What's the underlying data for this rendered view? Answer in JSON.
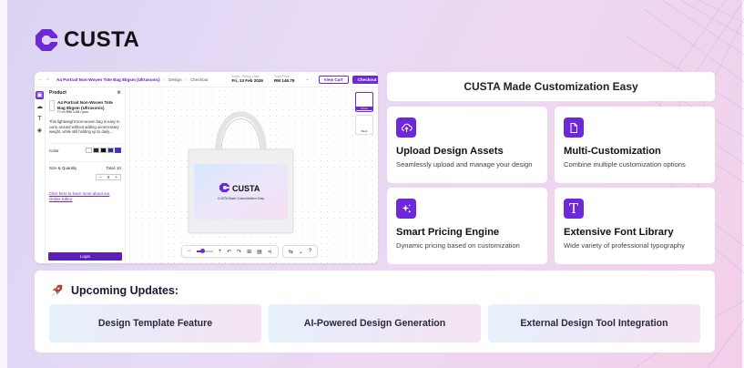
{
  "brand": {
    "name": "CUSTA",
    "accent": "#6d28d9"
  },
  "app": {
    "product_title": "A4 Portrait Non-Woven Tote Bag 8bgsm (Ultrasonic)",
    "breadcrumb_design": "Design",
    "breadcrumb_checkout": "Checkout",
    "pickup_label": "Estim. Pickup Date",
    "pickup_date": "Fri, 13 Feb 2026",
    "total_label": "Total Price",
    "total_price": "RM 146.79",
    "view_cart": "View Cart",
    "checkout": "Checkout",
    "panel_title": "Product",
    "product_name": "A4 Portrait Non-Woven Tote Bag 8bgsm (Ultrasonic)",
    "product_price_prefix": "From",
    "product_price": "RM 1.08 / pcs",
    "description": "This lightweight non-woven bag is easy to carry around without adding unnecessary weight, while still holding up to daily...",
    "color_label": "Color",
    "size_label": "Size & Quantity",
    "total_qty_label": "Total: 10",
    "qty_value": "0",
    "help_link": "Click here to learn more about our Online Editor",
    "login": "Login",
    "bag_brand": "CUSTA",
    "bag_tagline": "CUSTA Made Customization Easy",
    "view_front": "Front",
    "view_back": "Back",
    "colors": [
      "#ffffff",
      "#1f2937",
      "#111111",
      "#1e3a8a",
      "#3b3b98"
    ]
  },
  "headline": "CUSTA Made Customization Easy",
  "cards": [
    {
      "title": "Upload Design Assets",
      "subtitle": "Seamlessly upload and manage your design",
      "icon": "cloud-upload-icon"
    },
    {
      "title": "Multi-Customization",
      "subtitle": "Combine multiple customization options",
      "icon": "document-icon"
    },
    {
      "title": "Smart Pricing Engine",
      "subtitle": "Dynamic pricing based on customization",
      "icon": "sparkles-icon"
    },
    {
      "title": "Extensive Font Library",
      "subtitle": "Wide variety of professional typography",
      "icon": "font-icon"
    }
  ],
  "updates": {
    "title": "Upcoming Updates:",
    "items": [
      "Design Template Feature",
      "AI-Powered Design Generation",
      "External Design Tool Integration"
    ]
  }
}
